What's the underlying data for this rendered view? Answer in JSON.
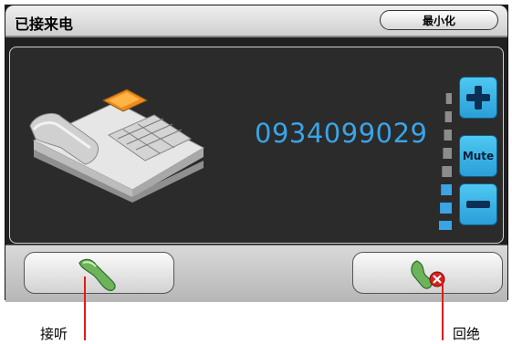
{
  "window": {
    "title": "已接来电",
    "minimize_label": "最小化"
  },
  "call": {
    "number": "0934099029"
  },
  "volume": {
    "mute_label": "Mute",
    "level": 0.375,
    "colors": {
      "active": "#3aa4e6",
      "inactive": "#8c8c8c"
    }
  },
  "actions": {
    "answer_icon": "phone-handset-answer-icon",
    "reject_icon": "phone-handset-reject-icon"
  },
  "callouts": {
    "answer": "接听",
    "reject": "回绝"
  }
}
